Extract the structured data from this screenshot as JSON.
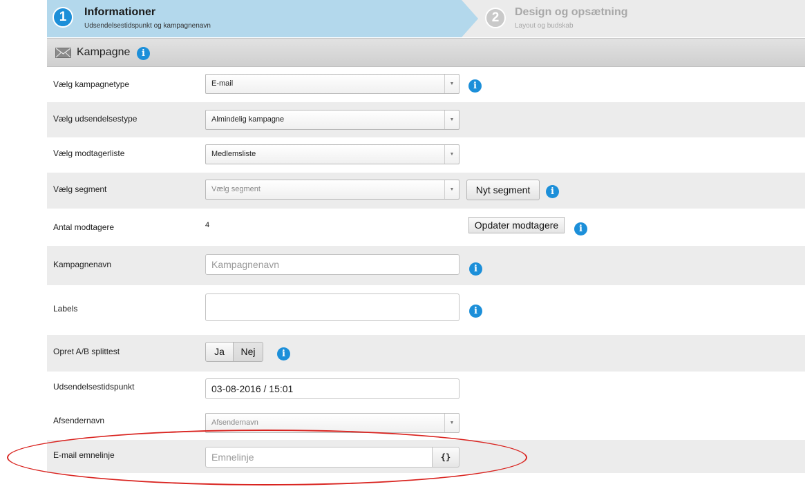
{
  "wizard": {
    "step1": {
      "number": "1",
      "title": "Informationer",
      "subtitle": "Udsendelsestidspunkt og kampagnenavn"
    },
    "step2": {
      "number": "2",
      "title": "Design og opsætning",
      "subtitle": "Layout og budskab"
    }
  },
  "section": {
    "title": "Kampagne",
    "info": "i"
  },
  "form": {
    "campaign_type": {
      "label": "Vælg kampagnetype",
      "value": "E-mail"
    },
    "send_type": {
      "label": "Vælg udsendelsestype",
      "value": "Almindelig kampagne"
    },
    "recipient_list": {
      "label": "Vælg modtagerliste",
      "value": "Medlemsliste"
    },
    "segment": {
      "label": "Vælg segment",
      "placeholder": "Vælg segment",
      "new_button": "Nyt segment"
    },
    "recipients_count": {
      "label": "Antal modtagere",
      "value": "4",
      "update_button": "Opdater modtagere"
    },
    "campaign_name": {
      "label": "Kampagnenavn",
      "placeholder": "Kampagnenavn"
    },
    "labels": {
      "label": "Labels"
    },
    "ab_test": {
      "label": "Opret A/B splittest",
      "yes": "Ja",
      "no": "Nej",
      "selected": "Nej"
    },
    "send_time": {
      "label": "Udsendelsestidspunkt",
      "value": "03-08-2016 / 15:01"
    },
    "sender_name": {
      "label": "Afsendernavn",
      "placeholder": "Afsendernavn"
    },
    "subject": {
      "label": "E-mail emnelinje",
      "placeholder": "Emnelinje",
      "merge_button": "{}"
    }
  },
  "colors": {
    "active_step": "#b3d8ec",
    "info_icon": "#1c8fd9",
    "highlight_ellipse": "#d9231f"
  }
}
